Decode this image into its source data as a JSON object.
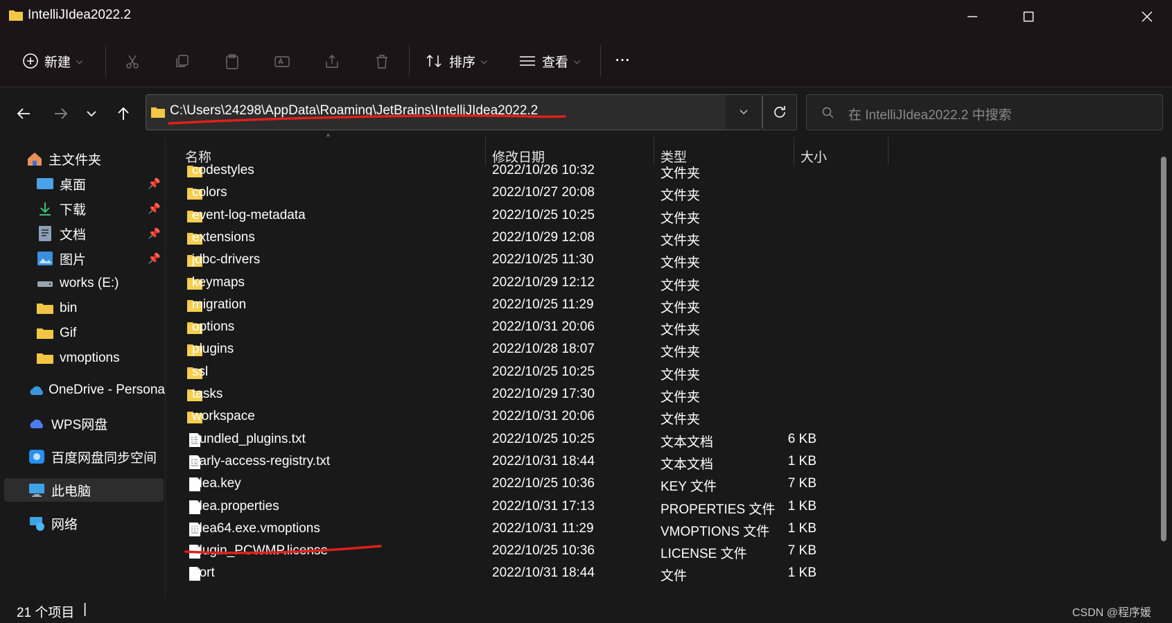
{
  "window": {
    "title": "IntelliJIdea2022.2"
  },
  "toolbar": {
    "new_label": "新建",
    "sort_label": "排序",
    "view_label": "查看",
    "more_label": "···"
  },
  "navbar": {
    "path": "C:\\Users\\24298\\AppData\\Roaming\\JetBrains\\IntelliJIdea2022.2",
    "search_placeholder": "在 IntelliJIdea2022.2 中搜索"
  },
  "sidebar": {
    "items": [
      {
        "label": "主文件夹",
        "icon": "home-icon"
      },
      {
        "label": "桌面",
        "icon": "desktop-icon",
        "pinned": true
      },
      {
        "label": "下载",
        "icon": "download-icon",
        "pinned": true
      },
      {
        "label": "文档",
        "icon": "document-icon",
        "pinned": true
      },
      {
        "label": "图片",
        "icon": "pictures-icon",
        "pinned": true
      },
      {
        "label": "works (E:)",
        "icon": "drive-icon"
      },
      {
        "label": "bin",
        "icon": "folder-icon"
      },
      {
        "label": "Gif",
        "icon": "folder-icon"
      },
      {
        "label": "vmoptions",
        "icon": "folder-icon"
      },
      {
        "label": "OneDrive - Persona",
        "icon": "onedrive-icon"
      },
      {
        "label": "WPS网盘",
        "icon": "cloud-icon"
      },
      {
        "label": "百度网盘同步空间",
        "icon": "baidu-icon"
      },
      {
        "label": "此电脑",
        "icon": "computer-icon",
        "selected": true
      },
      {
        "label": "网络",
        "icon": "network-icon"
      }
    ]
  },
  "columns": {
    "name": "名称",
    "date": "修改日期",
    "type": "类型",
    "size": "大小"
  },
  "files": [
    {
      "name": "codestyles",
      "date": "2022/10/26 10:32",
      "type": "文件夹",
      "size": "",
      "kind": "folder"
    },
    {
      "name": "colors",
      "date": "2022/10/27 20:08",
      "type": "文件夹",
      "size": "",
      "kind": "folder"
    },
    {
      "name": "event-log-metadata",
      "date": "2022/10/25 10:25",
      "type": "文件夹",
      "size": "",
      "kind": "folder"
    },
    {
      "name": "extensions",
      "date": "2022/10/29 12:08",
      "type": "文件夹",
      "size": "",
      "kind": "folder"
    },
    {
      "name": "jdbc-drivers",
      "date": "2022/10/25 11:30",
      "type": "文件夹",
      "size": "",
      "kind": "folder"
    },
    {
      "name": "keymaps",
      "date": "2022/10/29 12:12",
      "type": "文件夹",
      "size": "",
      "kind": "folder"
    },
    {
      "name": "migration",
      "date": "2022/10/25 11:29",
      "type": "文件夹",
      "size": "",
      "kind": "folder"
    },
    {
      "name": "options",
      "date": "2022/10/31 20:06",
      "type": "文件夹",
      "size": "",
      "kind": "folder"
    },
    {
      "name": "plugins",
      "date": "2022/10/28 18:07",
      "type": "文件夹",
      "size": "",
      "kind": "folder"
    },
    {
      "name": "ssl",
      "date": "2022/10/25 10:25",
      "type": "文件夹",
      "size": "",
      "kind": "folder"
    },
    {
      "name": "tasks",
      "date": "2022/10/29 17:30",
      "type": "文件夹",
      "size": "",
      "kind": "folder"
    },
    {
      "name": "workspace",
      "date": "2022/10/31 20:06",
      "type": "文件夹",
      "size": "",
      "kind": "folder"
    },
    {
      "name": "bundled_plugins.txt",
      "date": "2022/10/25 10:25",
      "type": "文本文档",
      "size": "6 KB",
      "kind": "text"
    },
    {
      "name": "early-access-registry.txt",
      "date": "2022/10/31 18:44",
      "type": "文本文档",
      "size": "1 KB",
      "kind": "text"
    },
    {
      "name": "idea.key",
      "date": "2022/10/25 10:36",
      "type": "KEY 文件",
      "size": "7 KB",
      "kind": "file"
    },
    {
      "name": "idea.properties",
      "date": "2022/10/31 17:13",
      "type": "PROPERTIES 文件",
      "size": "1 KB",
      "kind": "file"
    },
    {
      "name": "idea64.exe.vmoptions",
      "date": "2022/10/31 11:29",
      "type": "VMOPTIONS 文件",
      "size": "1 KB",
      "kind": "text"
    },
    {
      "name": "plugin_PCWMP.license",
      "date": "2022/10/25 10:36",
      "type": "LICENSE 文件",
      "size": "7 KB",
      "kind": "file"
    },
    {
      "name": "port",
      "date": "2022/10/31 18:44",
      "type": "文件",
      "size": "1 KB",
      "kind": "file"
    }
  ],
  "status": {
    "count": "21 个项目"
  },
  "watermark": "CSDN @程序媛",
  "colors": {
    "annotation": "#e0201b",
    "folder": "#f3c744"
  }
}
